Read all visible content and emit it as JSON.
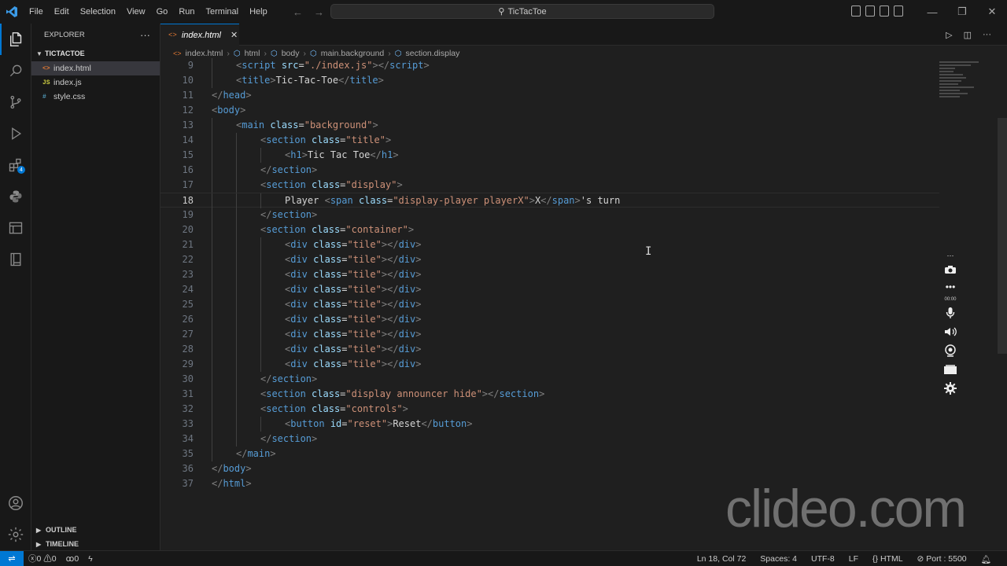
{
  "titlebar": {
    "menu": [
      "File",
      "Edit",
      "Selection",
      "View",
      "Go",
      "Run",
      "Terminal",
      "Help"
    ],
    "command_center": "TicTacToe"
  },
  "sidebar": {
    "title": "EXPLORER",
    "folder": "TICTACTOE",
    "files": [
      {
        "name": "index.html",
        "icon": "<>",
        "color": "#e37933"
      },
      {
        "name": "index.js",
        "icon": "JS",
        "color": "#cbcb41"
      },
      {
        "name": "style.css",
        "icon": "#",
        "color": "#519aba"
      }
    ],
    "outline": "OUTLINE",
    "timeline": "TIMELINE"
  },
  "tab": {
    "label": "index.html"
  },
  "breadcrumb": [
    "index.html",
    "html",
    "body",
    "main.background",
    "section.display"
  ],
  "editor": {
    "current_line": 18,
    "lines": [
      {
        "n": "9",
        "i": 1,
        "code": [
          [
            "t",
            "<"
          ],
          [
            "n",
            "script"
          ],
          [
            "x",
            " "
          ],
          [
            "a",
            "src"
          ],
          [
            "x",
            "="
          ],
          [
            "s",
            "\"./index.js\""
          ],
          [
            "t",
            ">"
          ],
          [
            "t",
            "</"
          ],
          [
            "n",
            "script"
          ],
          [
            "t",
            ">"
          ]
        ]
      },
      {
        "n": "10",
        "i": 1,
        "code": [
          [
            "t",
            "<"
          ],
          [
            "n",
            "title"
          ],
          [
            "t",
            ">"
          ],
          [
            "x",
            "Tic-Tac-Toe"
          ],
          [
            "t",
            "</"
          ],
          [
            "n",
            "title"
          ],
          [
            "t",
            ">"
          ]
        ]
      },
      {
        "n": "11",
        "i": 0,
        "code": [
          [
            "t",
            "</"
          ],
          [
            "n",
            "head"
          ],
          [
            "t",
            ">"
          ]
        ]
      },
      {
        "n": "12",
        "i": 0,
        "code": [
          [
            "t",
            "<"
          ],
          [
            "n",
            "body"
          ],
          [
            "t",
            ">"
          ]
        ]
      },
      {
        "n": "13",
        "i": 1,
        "code": [
          [
            "t",
            "<"
          ],
          [
            "n",
            "main"
          ],
          [
            "x",
            " "
          ],
          [
            "a",
            "class"
          ],
          [
            "x",
            "="
          ],
          [
            "s",
            "\"background\""
          ],
          [
            "t",
            ">"
          ]
        ]
      },
      {
        "n": "14",
        "i": 2,
        "code": [
          [
            "t",
            "<"
          ],
          [
            "n",
            "section"
          ],
          [
            "x",
            " "
          ],
          [
            "a",
            "class"
          ],
          [
            "x",
            "="
          ],
          [
            "s",
            "\"title\""
          ],
          [
            "t",
            ">"
          ]
        ]
      },
      {
        "n": "15",
        "i": 3,
        "code": [
          [
            "t",
            "<"
          ],
          [
            "n",
            "h1"
          ],
          [
            "t",
            ">"
          ],
          [
            "x",
            "Tic Tac Toe"
          ],
          [
            "t",
            "</"
          ],
          [
            "n",
            "h1"
          ],
          [
            "t",
            ">"
          ]
        ]
      },
      {
        "n": "16",
        "i": 2,
        "code": [
          [
            "t",
            "</"
          ],
          [
            "n",
            "section"
          ],
          [
            "t",
            ">"
          ]
        ]
      },
      {
        "n": "17",
        "i": 2,
        "code": [
          [
            "t",
            "<"
          ],
          [
            "n",
            "section"
          ],
          [
            "x",
            " "
          ],
          [
            "a",
            "class"
          ],
          [
            "x",
            "="
          ],
          [
            "s",
            "\"display\""
          ],
          [
            "t",
            ">"
          ]
        ]
      },
      {
        "n": "18",
        "i": 3,
        "code": [
          [
            "x",
            "Player "
          ],
          [
            "t",
            "<"
          ],
          [
            "n",
            "span"
          ],
          [
            "x",
            " "
          ],
          [
            "a",
            "class"
          ],
          [
            "x",
            "="
          ],
          [
            "s",
            "\"display-player playerX\""
          ],
          [
            "t",
            ">"
          ],
          [
            "x",
            "X"
          ],
          [
            "t",
            "</"
          ],
          [
            "n",
            "span"
          ],
          [
            "t",
            ">"
          ],
          [
            "x",
            "'s turn"
          ]
        ]
      },
      {
        "n": "19",
        "i": 2,
        "code": [
          [
            "t",
            "</"
          ],
          [
            "n",
            "section"
          ],
          [
            "t",
            ">"
          ]
        ]
      },
      {
        "n": "20",
        "i": 2,
        "code": [
          [
            "t",
            "<"
          ],
          [
            "n",
            "section"
          ],
          [
            "x",
            " "
          ],
          [
            "a",
            "class"
          ],
          [
            "x",
            "="
          ],
          [
            "s",
            "\"container\""
          ],
          [
            "t",
            ">"
          ]
        ]
      },
      {
        "n": "21",
        "i": 3,
        "code": [
          [
            "t",
            "<"
          ],
          [
            "n",
            "div"
          ],
          [
            "x",
            " "
          ],
          [
            "a",
            "class"
          ],
          [
            "x",
            "="
          ],
          [
            "s",
            "\"tile\""
          ],
          [
            "t",
            ">"
          ],
          [
            "t",
            "</"
          ],
          [
            "n",
            "div"
          ],
          [
            "t",
            ">"
          ]
        ]
      },
      {
        "n": "22",
        "i": 3,
        "code": [
          [
            "t",
            "<"
          ],
          [
            "n",
            "div"
          ],
          [
            "x",
            " "
          ],
          [
            "a",
            "class"
          ],
          [
            "x",
            "="
          ],
          [
            "s",
            "\"tile\""
          ],
          [
            "t",
            ">"
          ],
          [
            "t",
            "</"
          ],
          [
            "n",
            "div"
          ],
          [
            "t",
            ">"
          ]
        ]
      },
      {
        "n": "23",
        "i": 3,
        "code": [
          [
            "t",
            "<"
          ],
          [
            "n",
            "div"
          ],
          [
            "x",
            " "
          ],
          [
            "a",
            "class"
          ],
          [
            "x",
            "="
          ],
          [
            "s",
            "\"tile\""
          ],
          [
            "t",
            ">"
          ],
          [
            "t",
            "</"
          ],
          [
            "n",
            "div"
          ],
          [
            "t",
            ">"
          ]
        ]
      },
      {
        "n": "24",
        "i": 3,
        "code": [
          [
            "t",
            "<"
          ],
          [
            "n",
            "div"
          ],
          [
            "x",
            " "
          ],
          [
            "a",
            "class"
          ],
          [
            "x",
            "="
          ],
          [
            "s",
            "\"tile\""
          ],
          [
            "t",
            ">"
          ],
          [
            "t",
            "</"
          ],
          [
            "n",
            "div"
          ],
          [
            "t",
            ">"
          ]
        ]
      },
      {
        "n": "25",
        "i": 3,
        "code": [
          [
            "t",
            "<"
          ],
          [
            "n",
            "div"
          ],
          [
            "x",
            " "
          ],
          [
            "a",
            "class"
          ],
          [
            "x",
            "="
          ],
          [
            "s",
            "\"tile\""
          ],
          [
            "t",
            ">"
          ],
          [
            "t",
            "</"
          ],
          [
            "n",
            "div"
          ],
          [
            "t",
            ">"
          ]
        ]
      },
      {
        "n": "26",
        "i": 3,
        "code": [
          [
            "t",
            "<"
          ],
          [
            "n",
            "div"
          ],
          [
            "x",
            " "
          ],
          [
            "a",
            "class"
          ],
          [
            "x",
            "="
          ],
          [
            "s",
            "\"tile\""
          ],
          [
            "t",
            ">"
          ],
          [
            "t",
            "</"
          ],
          [
            "n",
            "div"
          ],
          [
            "t",
            ">"
          ]
        ]
      },
      {
        "n": "27",
        "i": 3,
        "code": [
          [
            "t",
            "<"
          ],
          [
            "n",
            "div"
          ],
          [
            "x",
            " "
          ],
          [
            "a",
            "class"
          ],
          [
            "x",
            "="
          ],
          [
            "s",
            "\"tile\""
          ],
          [
            "t",
            ">"
          ],
          [
            "t",
            "</"
          ],
          [
            "n",
            "div"
          ],
          [
            "t",
            ">"
          ]
        ]
      },
      {
        "n": "28",
        "i": 3,
        "code": [
          [
            "t",
            "<"
          ],
          [
            "n",
            "div"
          ],
          [
            "x",
            " "
          ],
          [
            "a",
            "class"
          ],
          [
            "x",
            "="
          ],
          [
            "s",
            "\"tile\""
          ],
          [
            "t",
            ">"
          ],
          [
            "t",
            "</"
          ],
          [
            "n",
            "div"
          ],
          [
            "t",
            ">"
          ]
        ]
      },
      {
        "n": "29",
        "i": 3,
        "code": [
          [
            "t",
            "<"
          ],
          [
            "n",
            "div"
          ],
          [
            "x",
            " "
          ],
          [
            "a",
            "class"
          ],
          [
            "x",
            "="
          ],
          [
            "s",
            "\"tile\""
          ],
          [
            "t",
            ">"
          ],
          [
            "t",
            "</"
          ],
          [
            "n",
            "div"
          ],
          [
            "t",
            ">"
          ]
        ]
      },
      {
        "n": "30",
        "i": 2,
        "code": [
          [
            "t",
            "</"
          ],
          [
            "n",
            "section"
          ],
          [
            "t",
            ">"
          ]
        ]
      },
      {
        "n": "31",
        "i": 2,
        "code": [
          [
            "t",
            "<"
          ],
          [
            "n",
            "section"
          ],
          [
            "x",
            " "
          ],
          [
            "a",
            "class"
          ],
          [
            "x",
            "="
          ],
          [
            "s",
            "\"display announcer hide\""
          ],
          [
            "t",
            ">"
          ],
          [
            "t",
            "</"
          ],
          [
            "n",
            "section"
          ],
          [
            "t",
            ">"
          ]
        ]
      },
      {
        "n": "32",
        "i": 2,
        "code": [
          [
            "t",
            "<"
          ],
          [
            "n",
            "section"
          ],
          [
            "x",
            " "
          ],
          [
            "a",
            "class"
          ],
          [
            "x",
            "="
          ],
          [
            "s",
            "\"controls\""
          ],
          [
            "t",
            ">"
          ]
        ]
      },
      {
        "n": "33",
        "i": 3,
        "code": [
          [
            "t",
            "<"
          ],
          [
            "n",
            "button"
          ],
          [
            "x",
            " "
          ],
          [
            "a",
            "id"
          ],
          [
            "x",
            "="
          ],
          [
            "s",
            "\"reset\""
          ],
          [
            "t",
            ">"
          ],
          [
            "x",
            "Reset"
          ],
          [
            "t",
            "</"
          ],
          [
            "n",
            "button"
          ],
          [
            "t",
            ">"
          ]
        ]
      },
      {
        "n": "34",
        "i": 2,
        "code": [
          [
            "t",
            "</"
          ],
          [
            "n",
            "section"
          ],
          [
            "t",
            ">"
          ]
        ]
      },
      {
        "n": "35",
        "i": 1,
        "code": [
          [
            "t",
            "</"
          ],
          [
            "n",
            "main"
          ],
          [
            "t",
            ">"
          ]
        ]
      },
      {
        "n": "36",
        "i": 0,
        "code": [
          [
            "t",
            "</"
          ],
          [
            "n",
            "body"
          ],
          [
            "t",
            ">"
          ]
        ]
      },
      {
        "n": "37",
        "i": 0,
        "code": [
          [
            "t",
            "</"
          ],
          [
            "n",
            "html"
          ],
          [
            "t",
            ">"
          ]
        ]
      }
    ]
  },
  "recorder": {
    "time": "00:00"
  },
  "watermark": "clideo.com",
  "statusbar": {
    "errors": "0",
    "warnings": "0",
    "ports": "0",
    "position": "Ln 18, Col 72",
    "spaces": "Spaces: 4",
    "encoding": "UTF-8",
    "eol": "LF",
    "language": "HTML",
    "port": "Port : 5500"
  },
  "colors": {
    "accent": "#0078d4",
    "editor_bg": "#1f1f1f",
    "sidebar_bg": "#181818"
  }
}
